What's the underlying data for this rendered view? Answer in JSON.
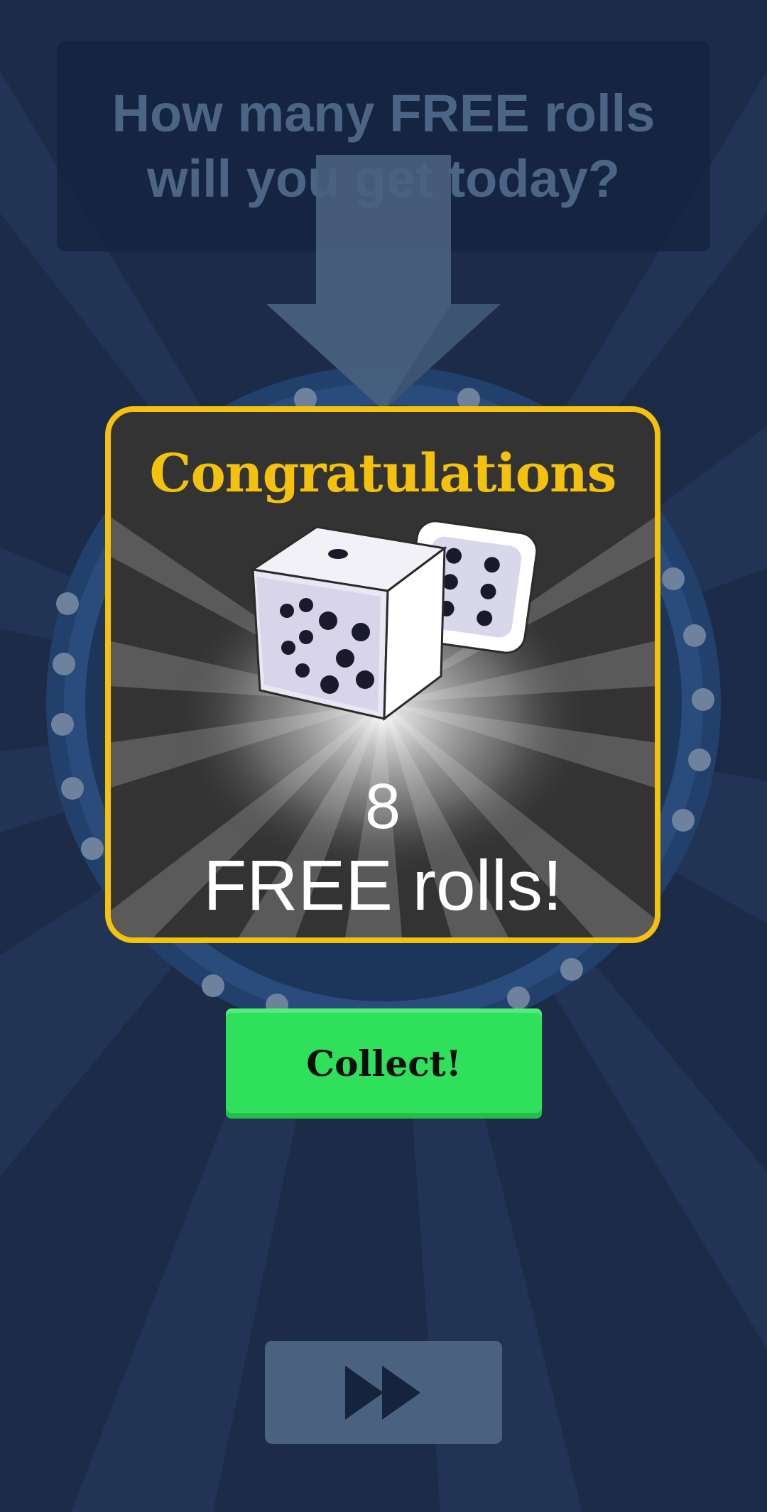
{
  "prompt": {
    "text": "How many FREE rolls will you get today?"
  },
  "reward_modal": {
    "title": "Congratulations",
    "count": "8",
    "label": "FREE rolls!"
  },
  "actions": {
    "collect_label": "Collect!",
    "skip_icon": "fast-forward-icon"
  },
  "colors": {
    "background": "#1b2b48",
    "modal_border": "#f4c20d",
    "title": "#f4c20d",
    "collect_button": "#2fe05a",
    "skip_button": "#4a6280"
  }
}
